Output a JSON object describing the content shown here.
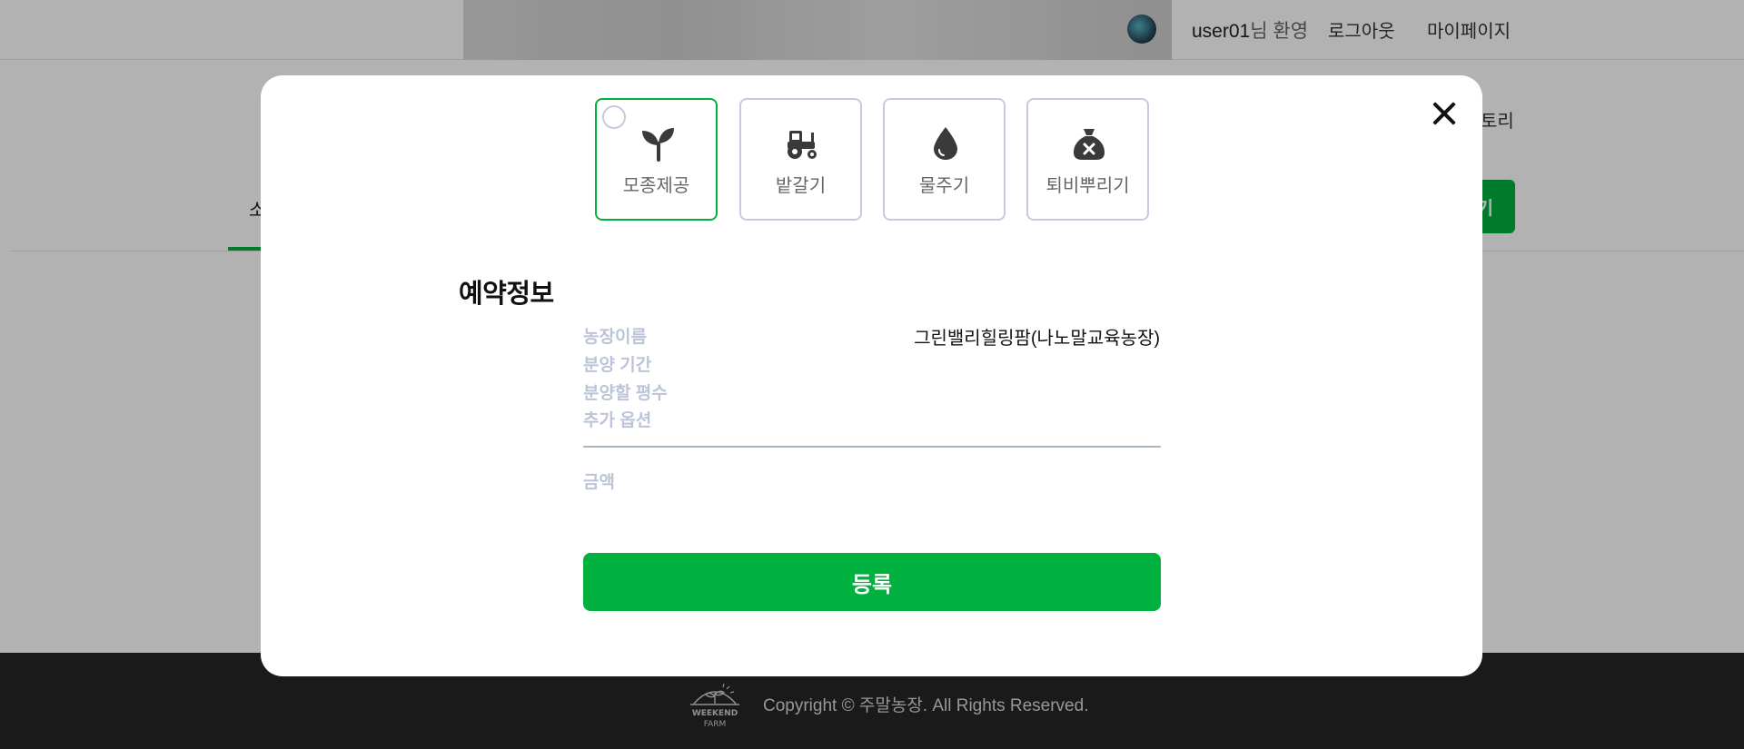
{
  "header": {
    "username": "user01",
    "welcome_suffix": "님 환영",
    "logout": "로그아웃",
    "mypage": "마이페이지"
  },
  "nav": {
    "right_partial": "토리",
    "tab_partial": "소",
    "button_partial": "기"
  },
  "modal": {
    "options": [
      {
        "label": "모종제공",
        "icon": "sprout-icon",
        "selected": true
      },
      {
        "label": "밭갈기",
        "icon": "tractor-icon",
        "selected": false
      },
      {
        "label": "물주기",
        "icon": "water-drop-icon",
        "selected": false
      },
      {
        "label": "퇴비뿌리기",
        "icon": "compost-bag-icon",
        "selected": false
      }
    ],
    "section_title": "예약정보",
    "fields": {
      "farm_name_label": "농장이름",
      "farm_name_value": "그린밸리힐링팜(나노말교육농장)",
      "period_label": "분양 기간",
      "area_label": "분양할 평수",
      "extra_label": "추가 옵션",
      "price_label": "금액"
    },
    "submit_label": "등록"
  },
  "footer": {
    "copyright": "Copyright © 주말농장. All Rights Reserved.",
    "logo_text_top": "WEEKEND",
    "logo_text_bottom": "FARM"
  },
  "colors": {
    "accent": "#00b140",
    "card_border": "#c4cbe0",
    "label": "#bcc4d7",
    "footer_bg": "#262626"
  }
}
